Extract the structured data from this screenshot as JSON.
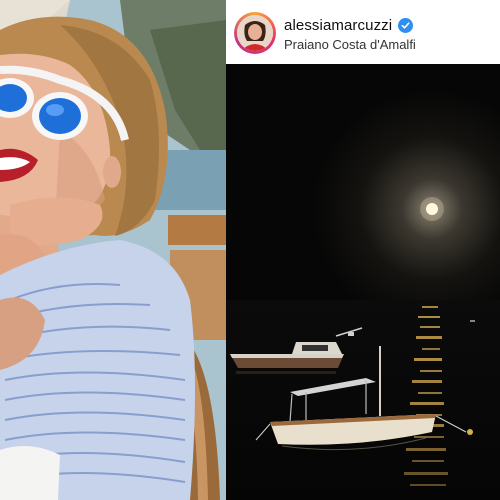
{
  "post_header": {
    "username": "alessiamarcuzzi",
    "location": "Praiano Costa d'Amalfi",
    "verified_badge_icon": "verified-check-icon",
    "badge_color": "#2f8ff1"
  },
  "photos": {
    "left": "portrait-photo",
    "right": "night-sea-moon-photo"
  }
}
